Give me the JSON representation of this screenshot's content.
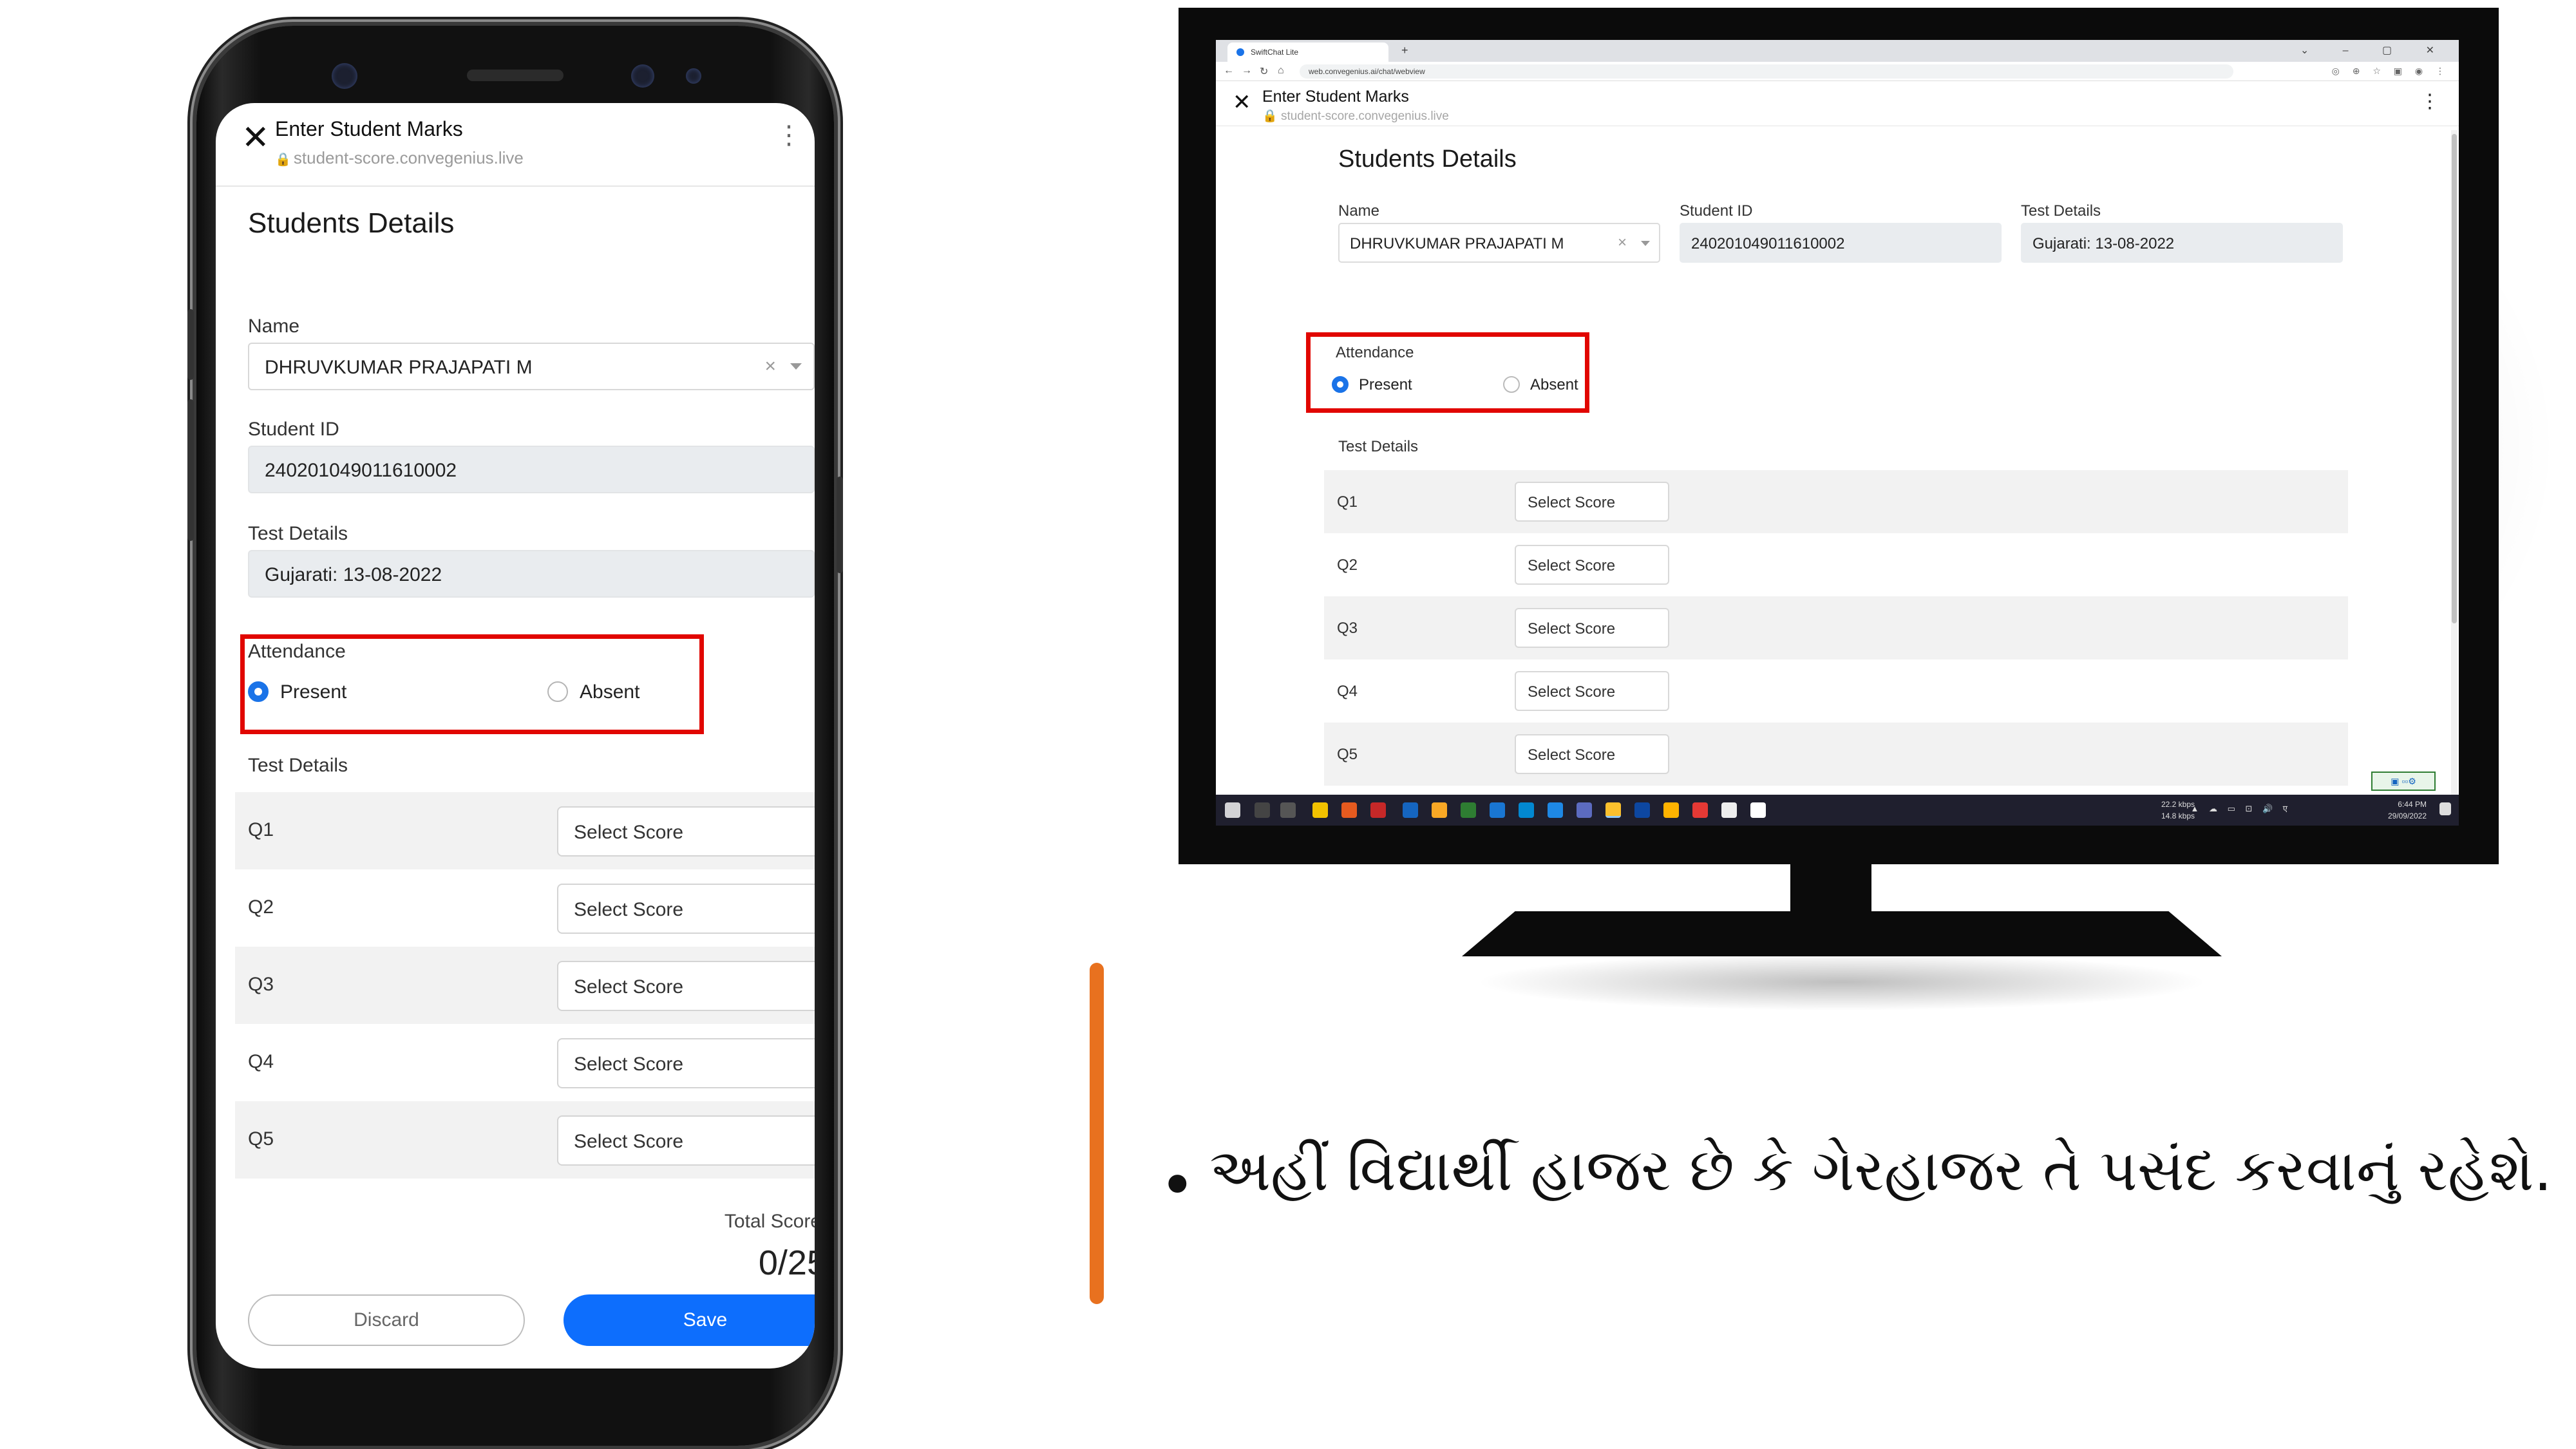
{
  "form": {
    "title": "Enter Student Marks",
    "url_phone": "student-score.convegenius.live",
    "url_monitor": "student-score.convegenius.live",
    "section_heading": "Students Details",
    "name_label": "Name",
    "name_value": "DHRUVKUMAR PRAJAPATI M",
    "student_id_label": "Student ID",
    "student_id_value": "240201049011610002",
    "test_details_label": "Test Details",
    "test_details_value": "Gujarati: 13-08-2022",
    "attendance_label": "Attendance",
    "attendance_options": [
      "Present",
      "Absent"
    ],
    "attendance_selected": "Present",
    "test_details_section_label": "Test Details",
    "questions": [
      {
        "label": "Q1",
        "placeholder": "Select Score"
      },
      {
        "label": "Q2",
        "placeholder": "Select Score"
      },
      {
        "label": "Q3",
        "placeholder": "Select Score"
      },
      {
        "label": "Q4",
        "placeholder": "Select Score"
      },
      {
        "label": "Q5",
        "placeholder": "Select Score"
      }
    ],
    "total_score_label": "Total Score",
    "total_score_value": "0/25",
    "discard_label": "Discard",
    "save_label": "Save",
    "clear_icon": "×"
  },
  "browser": {
    "tab_title": "SwiftChat Lite",
    "address": "web.convegenius.ai/chat/webview"
  },
  "taskbar": {
    "net_up": "22.2 kbps",
    "net_down": "14.8 kbps",
    "time": "6:44 PM",
    "date": "29/09/2022"
  },
  "caption": {
    "bullet": "•",
    "text": "અહીં વિદ્યાર્થી હાજર છે કે ગેરહાજર તે પસંદ કરવાનું રહેશે."
  },
  "colors": {
    "accent_blue": "#0d6efd",
    "radio_blue": "#1a73e8",
    "highlight_red": "#e10600",
    "divider_orange": "#e8711f"
  },
  "icons": [
    "close-icon",
    "kebab-menu-icon",
    "lock-icon",
    "chevron-down-icon",
    "clear-icon",
    "radio-icon"
  ]
}
